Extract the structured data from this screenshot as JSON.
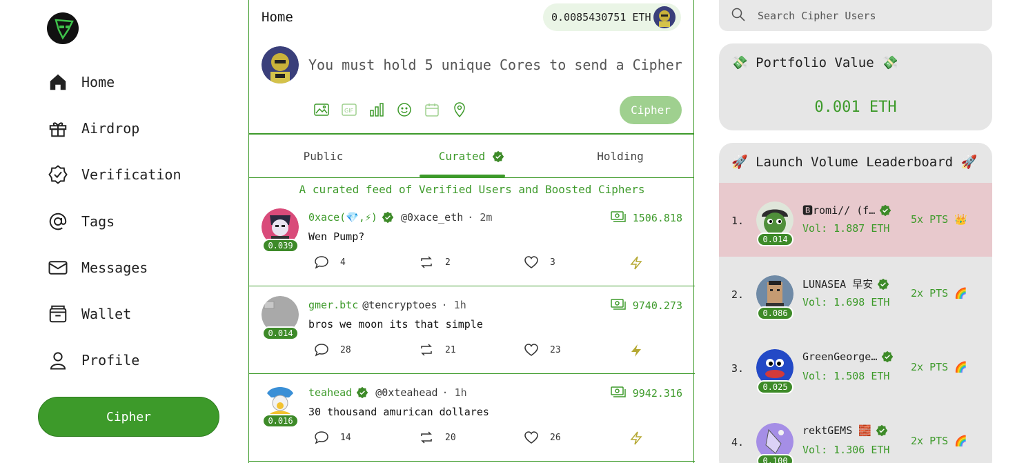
{
  "sidebar": {
    "items": [
      {
        "label": "Home",
        "icon": "home-icon"
      },
      {
        "label": "Airdrop",
        "icon": "gift-icon"
      },
      {
        "label": "Verification",
        "icon": "verified-badge-icon"
      },
      {
        "label": "Tags",
        "icon": "at-sign-icon"
      },
      {
        "label": "Messages",
        "icon": "envelope-icon"
      },
      {
        "label": "Wallet",
        "icon": "wallet-icon"
      },
      {
        "label": "Profile",
        "icon": "user-icon"
      }
    ],
    "cipher_button": "Cipher"
  },
  "feed": {
    "title": "Home",
    "eth_balance": "0.0085430751 ETH",
    "compose_placeholder": "You must hold 5 unique Cores to send a Cipher",
    "compose_button": "Cipher",
    "compose_tools": [
      "image-icon",
      "gif-icon",
      "poll-icon",
      "emoji-icon",
      "schedule-icon",
      "location-icon"
    ],
    "tabs": [
      {
        "label": "Public",
        "active": false
      },
      {
        "label": "Curated",
        "active": true
      },
      {
        "label": "Holding",
        "active": false
      }
    ],
    "note": "A curated feed of Verified Users and Boosted Ciphers",
    "posts": [
      {
        "badge": "0.039",
        "name": "0xace(💎,⚡)",
        "verified": true,
        "handle": "@0xace_eth",
        "time": "· 2m",
        "amount": "1506.818",
        "body": "Wen Pump?",
        "replies": "4",
        "reposts": "2",
        "likes": "3"
      },
      {
        "badge": "0.014",
        "name": "gmer.btc",
        "verified": false,
        "handle": "@tencryptoes",
        "time": "· 1h",
        "amount": "9740.273",
        "body": "bros we moon its that simple",
        "replies": "28",
        "reposts": "21",
        "likes": "23"
      },
      {
        "badge": "0.016",
        "name": "teahead",
        "verified": true,
        "handle": "@0xteahead",
        "time": "· 1h",
        "amount": "9942.316",
        "body": "30 thousand amurican dollares",
        "replies": "14",
        "reposts": "20",
        "likes": "26"
      }
    ]
  },
  "right": {
    "search_placeholder": "Search Cipher Users",
    "portfolio": {
      "title": "💸 Portfolio Value 💸",
      "value": "0.001 ETH"
    },
    "leaderboard": {
      "title": "🚀 Launch Volume Leaderboard 🚀",
      "rows": [
        {
          "rank": "1.",
          "badge": "0.014",
          "name": "🅱romi// (f…",
          "vol": "Vol: 1.887 ETH",
          "pts": "5x PTS 👑"
        },
        {
          "rank": "2.",
          "badge": "0.086",
          "name": "LUNASEA 早安",
          "vol": "Vol: 1.698 ETH",
          "pts": "2x PTS 🌈"
        },
        {
          "rank": "3.",
          "badge": "0.025",
          "name": "GreenGeorge…",
          "vol": "Vol: 1.508 ETH",
          "pts": "2x PTS 🌈"
        },
        {
          "rank": "4.",
          "badge": "0.100",
          "name": "rektGEMS 🧱",
          "vol": "Vol: 1.306 ETH",
          "pts": "2x PTS 🌈"
        }
      ]
    }
  },
  "colors": {
    "accent": "#3d9a2a",
    "accent_light": "#9fd08f",
    "highlight_row": "#e8c9cd",
    "card_bg": "#e6e6e6"
  }
}
